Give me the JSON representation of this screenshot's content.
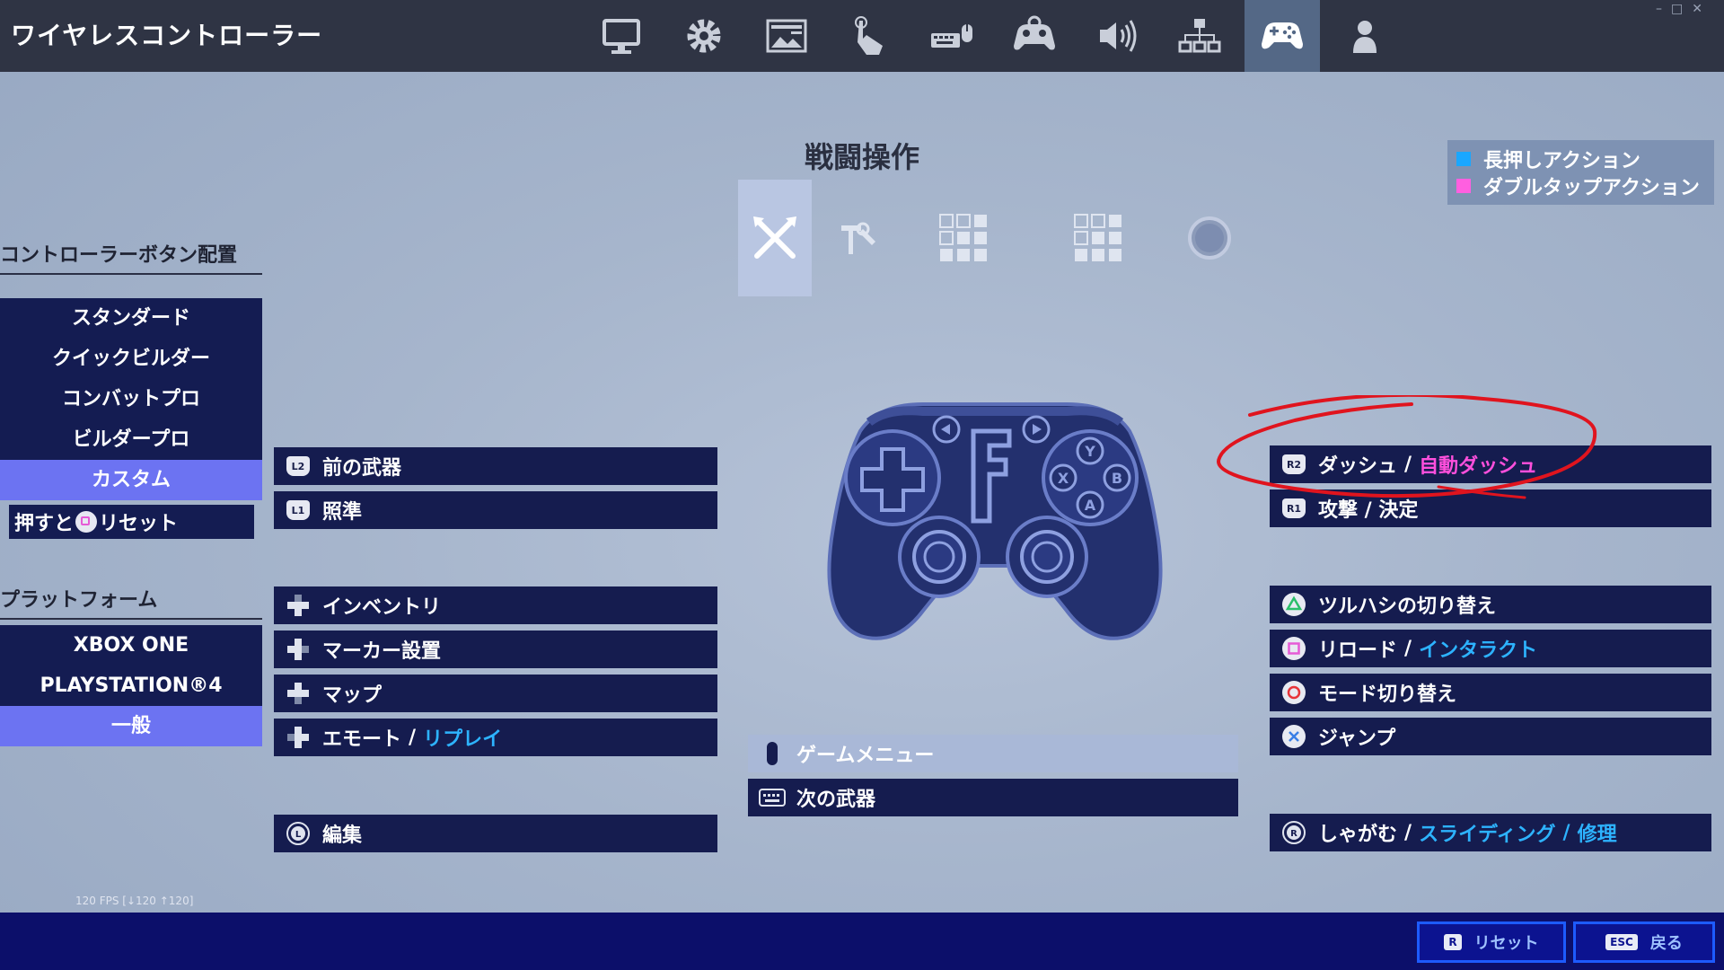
{
  "window": {
    "title": "ワイヤレスコントローラー",
    "controls": "–□✕"
  },
  "top_tabs": [
    {
      "icon": "monitor-icon"
    },
    {
      "icon": "gear-icon"
    },
    {
      "icon": "hud-layout-icon"
    },
    {
      "icon": "touch-icon"
    },
    {
      "icon": "keyboard-mouse-icon"
    },
    {
      "icon": "controller-settings-icon"
    },
    {
      "icon": "speaker-icon"
    },
    {
      "icon": "network-icon"
    },
    {
      "icon": "gamepad-icon",
      "active": true
    },
    {
      "icon": "account-icon"
    }
  ],
  "section": {
    "title": "戦闘操作"
  },
  "legend": {
    "items": [
      {
        "label": "長押しアクション",
        "color": "#1aa7ff"
      },
      {
        "label": "ダブルタップアクション",
        "color": "#ff5fe0"
      }
    ]
  },
  "category_tabs": [
    {
      "icon": "crossed-swords-icon",
      "active": true
    },
    {
      "icon": "build-tools-icon"
    },
    {
      "icon": "grid-icon"
    },
    {
      "icon": "grid-alt-icon"
    },
    {
      "icon": "circle-icon"
    }
  ],
  "sidebar": {
    "layout_heading": "コントローラーボタン配置",
    "layouts": [
      "スタンダード",
      "クイックビルダー",
      "コンバットプロ",
      "ビルダープロ",
      "カスタム"
    ],
    "active_layout": "カスタム",
    "reset_hint_prefix": "押すと",
    "reset_hint_suffix": "リセット",
    "platform_heading": "プラットフォーム",
    "platforms": [
      "XBOX ONE",
      "PLAYSTATION®4",
      "一般"
    ],
    "active_platform": "一般"
  },
  "left_bindings": [
    {
      "key": "L2",
      "label": "前の武器"
    },
    {
      "key": "L1",
      "label": "照準"
    },
    {
      "key": "dpad",
      "label": "インベントリ"
    },
    {
      "key": "dpad",
      "label": "マーカー設置"
    },
    {
      "key": "dpad",
      "label": "マップ"
    },
    {
      "key": "dpad",
      "label": "エモート",
      "alt": "リプレイ",
      "alt_color": "blue"
    },
    {
      "key": "L3",
      "label": "編集"
    }
  ],
  "center_bindings": [
    {
      "key": "options",
      "label": "ゲームメニュー",
      "highlight": true
    },
    {
      "key": "touchpad",
      "label": "次の武器"
    }
  ],
  "right_bindings": [
    {
      "key": "R2",
      "label": "ダッシュ",
      "alt": "自動ダッシュ",
      "alt_color": "pink"
    },
    {
      "key": "R1",
      "label": "攻撃 / 決定"
    },
    {
      "key": "triangle",
      "label": "ツルハシの切り替え"
    },
    {
      "key": "square",
      "label": "リロード",
      "alt": "インタラクト",
      "alt_color": "blue"
    },
    {
      "key": "circle",
      "label": "モード切り替え"
    },
    {
      "key": "cross",
      "label": "ジャンプ"
    },
    {
      "key": "R3",
      "label": "しゃがむ",
      "alt": "スライディング",
      "alt2": "修理",
      "alt_color": "blue"
    }
  ],
  "controller": {
    "face_buttons": [
      "Y",
      "X",
      "B",
      "A"
    ],
    "logo": "F"
  },
  "footer": {
    "fps": "120 FPS [↓120 ↑120]",
    "buttons": [
      {
        "key": "R",
        "label": "リセット"
      },
      {
        "key": "ESC",
        "label": "戻る"
      }
    ]
  },
  "colors": {
    "accent": "#6c73f2",
    "panel": "#151c4f",
    "topbar": "#2f3444",
    "annotation": "#e0141e"
  }
}
